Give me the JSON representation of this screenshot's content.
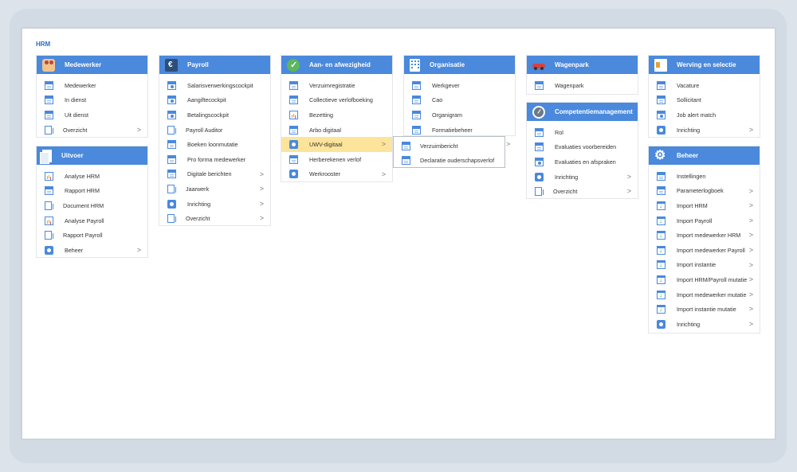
{
  "page": {
    "title": "HRM"
  },
  "panels": {
    "medewerker": {
      "title": "Medewerker",
      "items": [
        {
          "label": "Medewerker"
        },
        {
          "label": "In dienst"
        },
        {
          "label": "Uit dienst"
        },
        {
          "label": "Overzicht"
        }
      ]
    },
    "uitvoer": {
      "title": "Uitvoer",
      "items": [
        {
          "label": "Analyse HRM"
        },
        {
          "label": "Rapport HRM"
        },
        {
          "label": "Document HRM"
        },
        {
          "label": "Analyse Payroll"
        },
        {
          "label": "Rapport Payroll"
        },
        {
          "label": "Beheer"
        }
      ]
    },
    "payroll": {
      "title": "Payroll",
      "items": [
        {
          "label": "Salarisverwerkingscockpit"
        },
        {
          "label": "Aangiftecockpit"
        },
        {
          "label": "Betalingscockpit"
        },
        {
          "label": "Payroll Auditor"
        },
        {
          "label": "Boeken loonmutatie"
        },
        {
          "label": "Pro forma medewerker"
        },
        {
          "label": "Digitale berichten"
        },
        {
          "label": "Jaarwerk"
        },
        {
          "label": "Inrichting"
        },
        {
          "label": "Overzicht"
        }
      ]
    },
    "aanafwezigheid": {
      "title": "Aan- en afwezigheid",
      "items": [
        {
          "label": "Verzuimregistratie"
        },
        {
          "label": "Collectieve verlofboeking"
        },
        {
          "label": "Bezetting"
        },
        {
          "label": "Arbo digitaal"
        },
        {
          "label": "UWV-digitaal"
        },
        {
          "label": "Herberekenen verlof"
        },
        {
          "label": "Werkrooster"
        }
      ]
    },
    "uwv_submenu": {
      "items": [
        {
          "label": "Verzuimbericht"
        },
        {
          "label": "Declaratie ouderschapsverlof"
        }
      ]
    },
    "organisatie": {
      "title": "Organisatie",
      "items": [
        {
          "label": "Werkgever"
        },
        {
          "label": "Cao"
        },
        {
          "label": "Organigram"
        },
        {
          "label": "Formatiebeheer"
        }
      ]
    },
    "wagenpark": {
      "title": "Wagenpark",
      "items": [
        {
          "label": "Wagenpark"
        }
      ]
    },
    "competentie": {
      "title": "Competentiemanagement",
      "items": [
        {
          "label": "Rol"
        },
        {
          "label": "Evaluaties voorbereiden"
        },
        {
          "label": "Evaluaties en afspraken"
        },
        {
          "label": "Inrichting"
        },
        {
          "label": "Overzicht"
        }
      ]
    },
    "werving": {
      "title": "Werving en selectie",
      "items": [
        {
          "label": "Vacature"
        },
        {
          "label": "Sollicitant"
        },
        {
          "label": "Job alert match"
        },
        {
          "label": "Inrichting"
        }
      ]
    },
    "beheer": {
      "title": "Beheer",
      "items": [
        {
          "label": "Instellingen"
        },
        {
          "label": "Parameterlogboek"
        },
        {
          "label": "Import HRM"
        },
        {
          "label": "Import Payroll"
        },
        {
          "label": "Import medewerker HRM"
        },
        {
          "label": "Import medewerker Payroll"
        },
        {
          "label": "Import instantie"
        },
        {
          "label": "Import HRM/Payroll mutatie"
        },
        {
          "label": "Import medewerker mutatie"
        },
        {
          "label": "Import instantie mutatie"
        },
        {
          "label": "Inrichting"
        }
      ]
    }
  },
  "icons": {
    "chevron": ">"
  },
  "colors": {
    "header_blue": "#4a89dc",
    "title_blue": "#2b6cc4",
    "active_highlight": "#fde49b"
  }
}
